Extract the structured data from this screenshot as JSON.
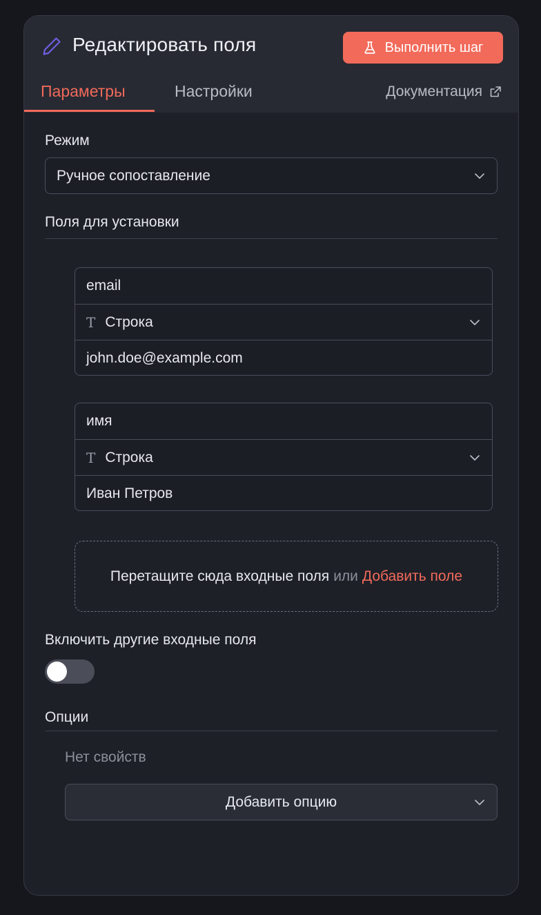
{
  "header": {
    "title": "Редактировать поля",
    "run_button_label": "Выполнить шаг"
  },
  "tabs": {
    "parameters": "Параметры",
    "settings": "Настройки",
    "documentation": "Документация",
    "active": "parameters"
  },
  "mode": {
    "label": "Режим",
    "value": "Ручное сопоставление"
  },
  "fields_section": {
    "label": "Поля для установки",
    "fields": [
      {
        "name": "email",
        "type": "Строка",
        "type_glyph": "T",
        "value": "john.doe@example.com"
      },
      {
        "name": "имя",
        "type": "Строка",
        "type_glyph": "T",
        "value": "Иван Петров"
      }
    ],
    "dropzone": {
      "text": "Перетащите сюда входные поля",
      "or": "или",
      "link": "Добавить поле"
    }
  },
  "include_other": {
    "label": "Включить другие входные поля",
    "enabled": false
  },
  "options": {
    "label": "Опции",
    "empty_text": "Нет свойств",
    "add_button": "Добавить опцию"
  },
  "colors": {
    "accent": "#f26a5a",
    "panel_bg": "#1e2028",
    "header_bg": "#272a33",
    "page_bg": "#16171d",
    "pencil": "#6f5fe0"
  }
}
